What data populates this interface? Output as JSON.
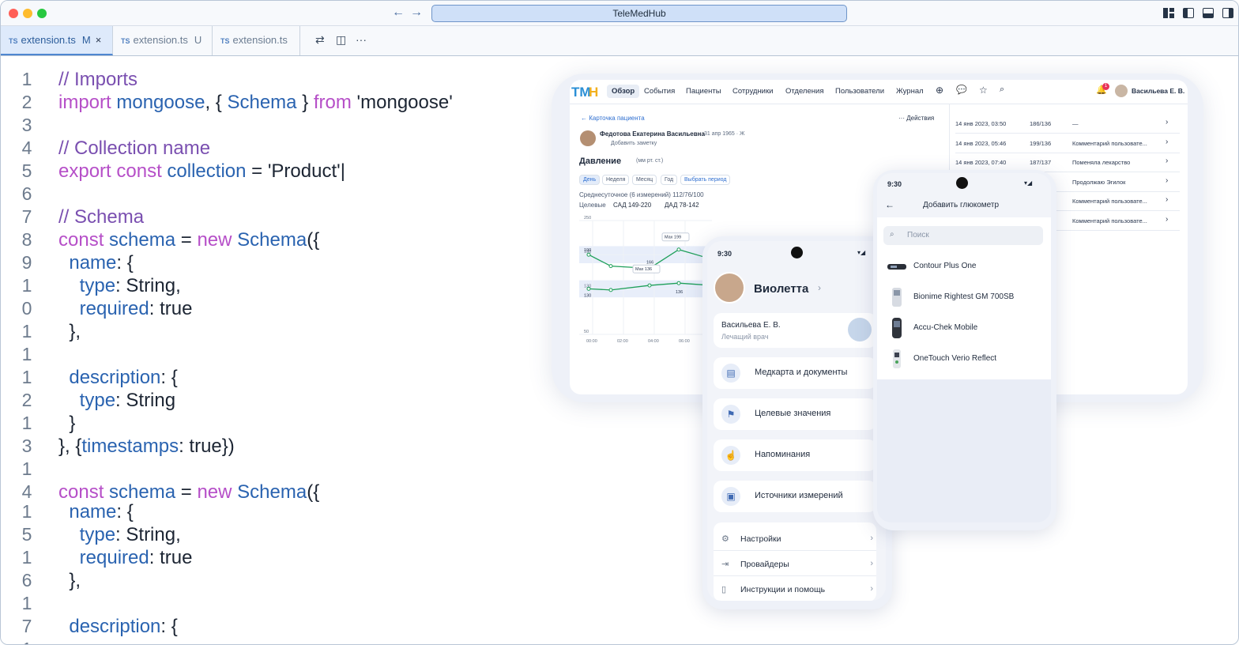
{
  "window": {
    "url_title": "TeleMedHub",
    "traffic_colors": [
      "#ff5f57",
      "#febc2e",
      "#28c840"
    ]
  },
  "tabs": [
    {
      "lang": "TS",
      "name": "extension.ts",
      "mark": "M",
      "close": "×"
    },
    {
      "lang": "TS",
      "name": "extension.ts",
      "mark": "U"
    },
    {
      "lang": "TS",
      "name": "extension.ts"
    }
  ],
  "tab_tools": {
    "more": "···"
  },
  "code": {
    "line_numbers": [
      "1",
      "2",
      "3",
      "4",
      "5",
      "6",
      "7",
      "8",
      "9",
      "1",
      "0",
      "1",
      "1",
      "1",
      "2",
      "1",
      "3",
      "1",
      "4",
      "1",
      "5",
      "1",
      "6",
      "1",
      "7",
      "1"
    ],
    "lines": [
      "// Imports",
      "import mongoose, { Schema } from 'mongoose'",
      "",
      "// Collection name",
      "export const collection = 'Product'|",
      "",
      "// Schema",
      "const schema = new Schema({",
      "  name: {",
      "    type: String,",
      "    required: true",
      "  },",
      "",
      "  description: {",
      "    type: String",
      "  }",
      "}, {timestamps: true})",
      "",
      "const schema = new Schema({",
      "  name: {",
      "    type: String,",
      "    required: true",
      "  },",
      "",
      "  description: {",
      ""
    ]
  },
  "tablet": {
    "nav": [
      "Обзор",
      "События",
      "Пациенты",
      "Сотрудники",
      "Отделения",
      "Пользователи",
      "Журнал"
    ],
    "user": "Васильева Е. В.",
    "notif_count": "1",
    "breadcrumb": "← Карточка пациента",
    "actions": "··· Действия",
    "patient_name": "Федотова Екатерина Васильевна",
    "patient_meta": "31 апр 1965 · Ж",
    "add_note": "Добавить заметку",
    "section": "Давление",
    "unit": "(мм рт. ст.)",
    "periods": [
      "День",
      "Неделя",
      "Месяц",
      "Год",
      "Выбрать период"
    ],
    "daily": "Среднесуточное (6 измерений)  112/76/100",
    "target_label": "Целевые",
    "target_sad": "САД  149-220",
    "target_dad": "ДАД 78-142",
    "right_rows": [
      {
        "date": "14 янв 2023, 03:50",
        "val": "186/136",
        "note": "—"
      },
      {
        "date": "14 янв 2023, 05:46",
        "val": "199/136",
        "note": "Комментарий пользовате..."
      },
      {
        "date": "14 янв 2023, 07:40",
        "val": "187/137",
        "note": "Поменяла лекарство"
      },
      {
        "date": "",
        "val": "",
        "note": "Продолжаю Эгилок"
      },
      {
        "date": "",
        "val": "",
        "note": "Комментарий пользовате..."
      },
      {
        "date": "",
        "val": "",
        "note": "Комментарий пользовате..."
      }
    ]
  },
  "chart_data": {
    "type": "line",
    "x": [
      "00:00",
      "02:00",
      "04:00",
      "06:00"
    ],
    "yticks": [
      "250",
      "190",
      "130",
      "50"
    ],
    "series": [
      {
        "values": [
          190,
          170,
          166,
          199,
          182
        ]
      },
      {
        "values": [
          130,
          128,
          136,
          140,
          136
        ]
      }
    ],
    "annotations": [
      "Max 199",
      "Max 136",
      "166",
      "136",
      "190",
      "130"
    ]
  },
  "phone1": {
    "time": "9:30",
    "name": "Виолетта",
    "doctor": "Васильева Е. В.",
    "doctor_role": "Лечащий врач",
    "menu": [
      {
        "label": "Медкарта и документы",
        "icon": "document-icon"
      },
      {
        "label": "Целевые значения",
        "icon": "flag-icon"
      },
      {
        "label": "Напоминания",
        "icon": "reminder-icon"
      },
      {
        "label": "Источники измерений",
        "icon": "devices-icon"
      }
    ],
    "settings": [
      {
        "label": "Настройки",
        "icon": "gear-icon"
      },
      {
        "label": "Провайдеры",
        "icon": "provider-icon"
      },
      {
        "label": "Инструкции и помощь",
        "icon": "book-icon"
      }
    ]
  },
  "phone2": {
    "time": "9:30",
    "title": "Добавить глюкометр",
    "search_placeholder": "Поиск",
    "devices": [
      "Contour Plus One",
      "Bionime Rightest GM 700SB",
      "Accu-Chek Mobile",
      "OneTouch Verio Reflect"
    ]
  }
}
